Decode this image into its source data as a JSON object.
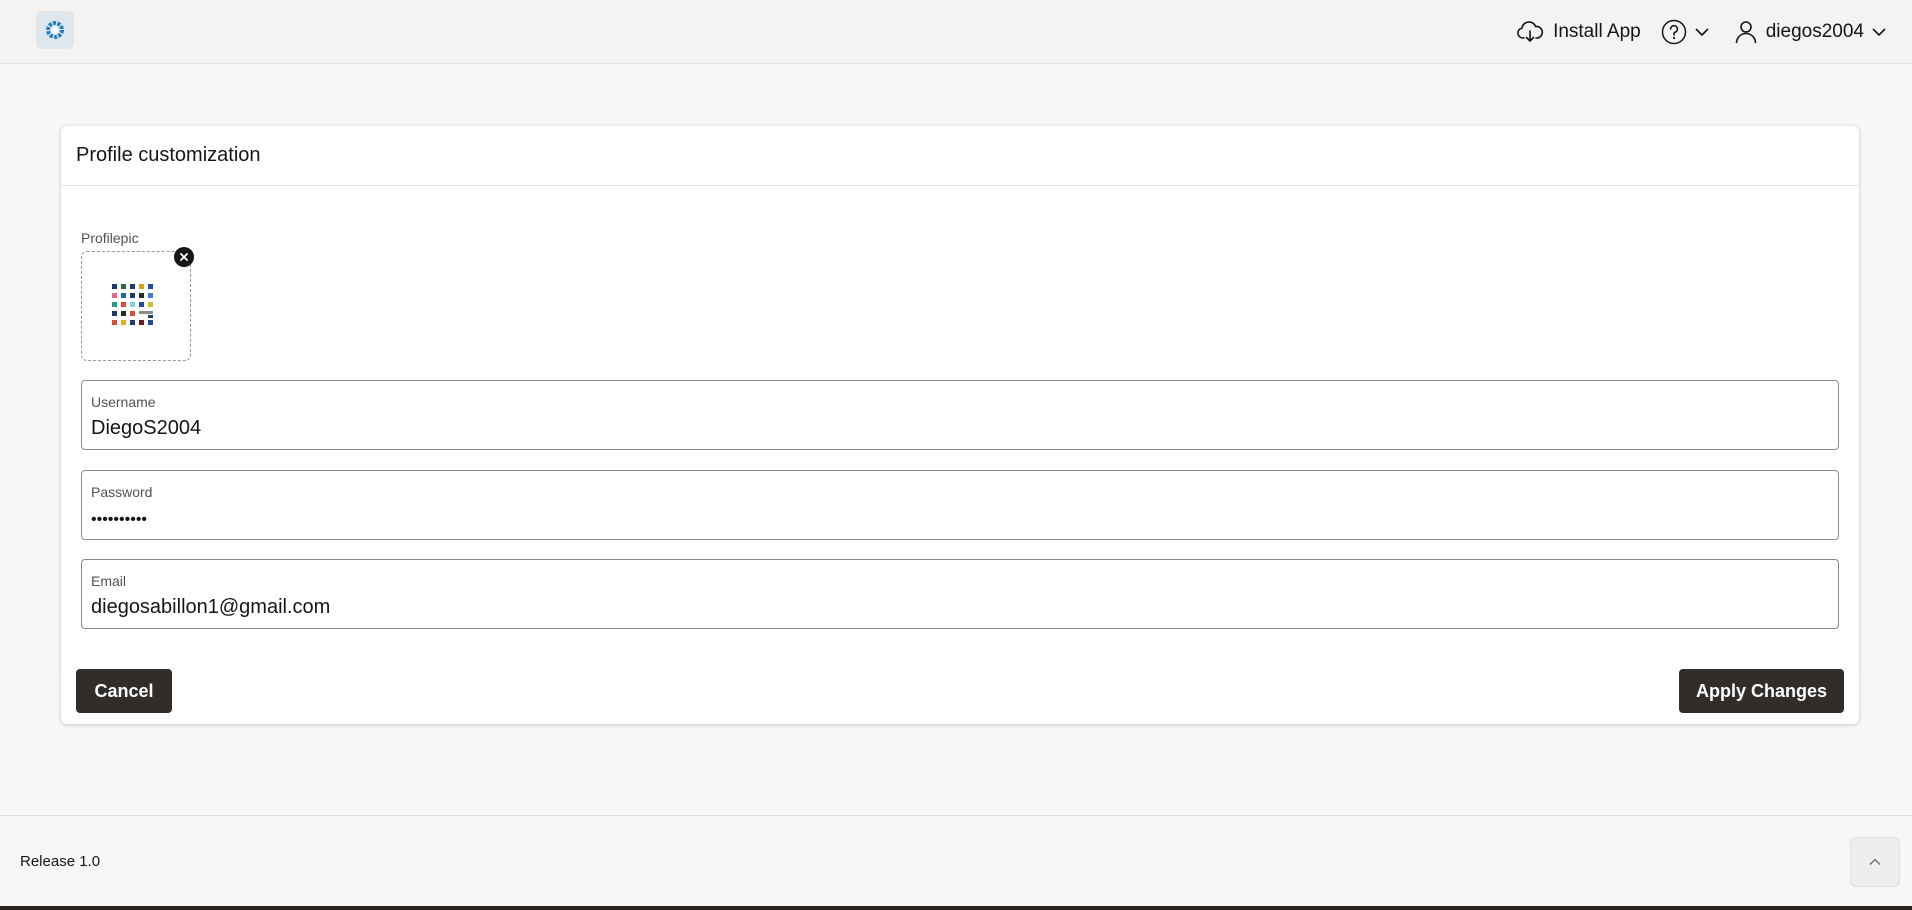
{
  "header": {
    "install_label": "Install App",
    "username": "diegos2004"
  },
  "form": {
    "title": "Profile customization",
    "profilepic_label": "Profilepic",
    "fields": [
      {
        "label": "Username",
        "value": "DiegoS2004"
      },
      {
        "label": "Password",
        "value": "••••••••••"
      },
      {
        "label": "Email",
        "value": "diegosabillon1@gmail.com"
      }
    ],
    "cancel_label": "Cancel",
    "apply_label": "Apply Changes"
  },
  "footer": {
    "release": "Release 1.0"
  },
  "colors": {
    "button_bg": "#312d2a",
    "accent": "#1d7ec2"
  },
  "icons": [
    "app-logo-icon",
    "cloud-download-icon",
    "help-icon",
    "chevron-down-icon",
    "user-icon",
    "close-icon",
    "chevron-up-icon"
  ]
}
